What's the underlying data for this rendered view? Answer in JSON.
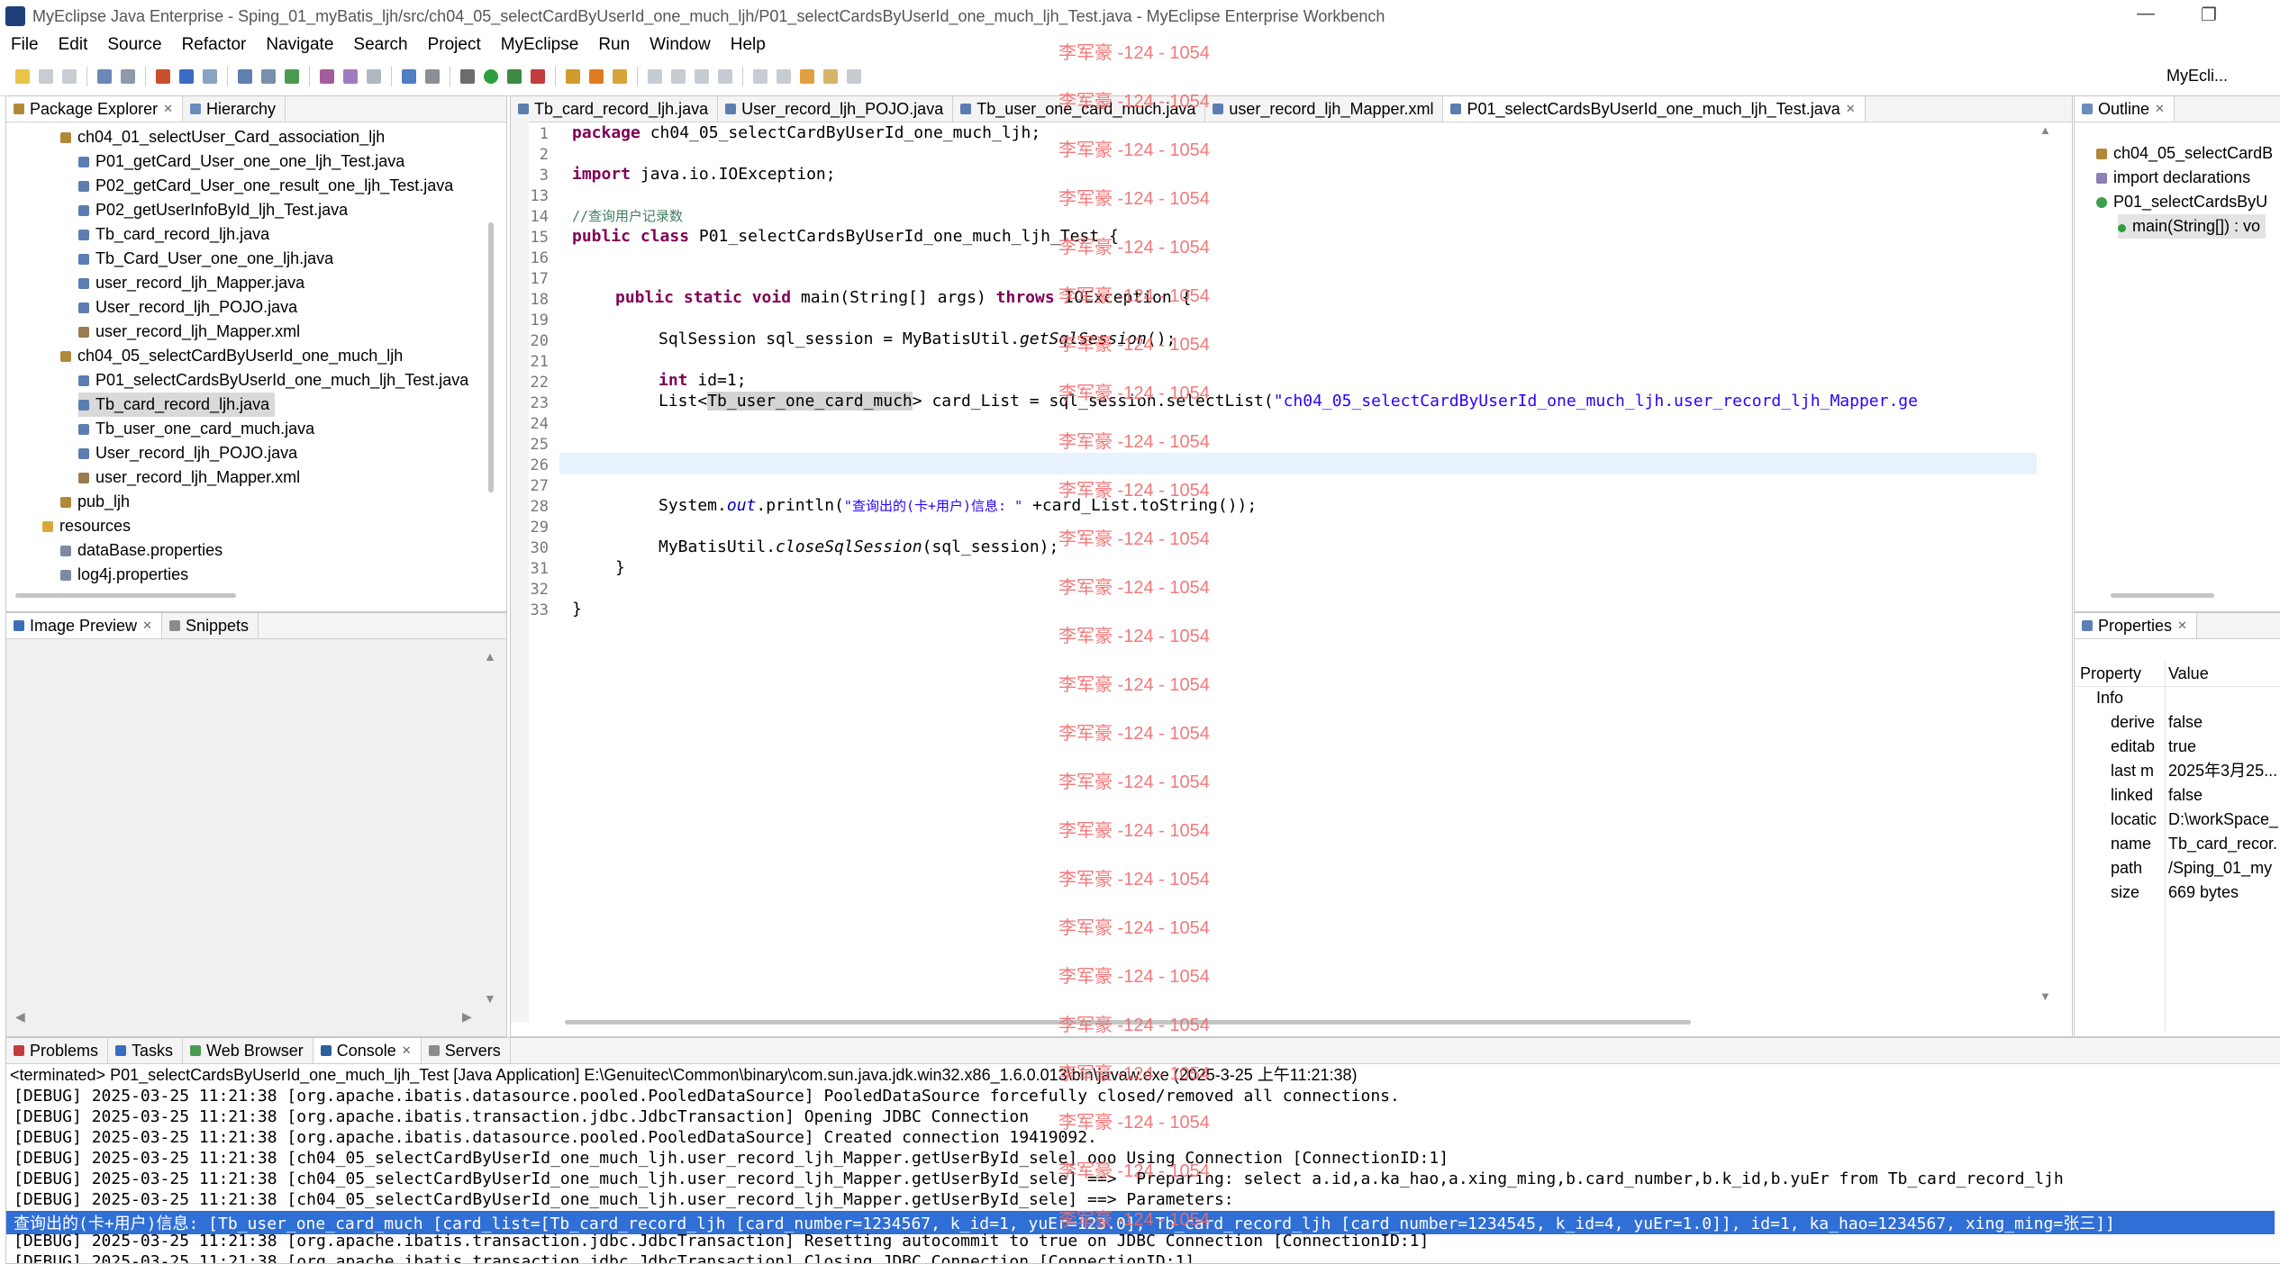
{
  "window": {
    "title": "MyEclipse Java Enterprise - Sping_01_myBatis_ljh/src/ch04_05_selectCardByUserId_one_much_ljh/P01_selectCardsByUserId_one_much_ljh_Test.java - MyEclipse Enterprise Workbench",
    "minimize": "—",
    "restore": "❐"
  },
  "menu": [
    "File",
    "Edit",
    "Source",
    "Refactor",
    "Navigate",
    "Search",
    "Project",
    "MyEclipse",
    "Run",
    "Window",
    "Help"
  ],
  "perspective": {
    "label": "MyEcli..."
  },
  "package_explorer": {
    "tab_label": "Package Explorer",
    "hierarchy_label": "Hierarchy",
    "items": [
      {
        "label": "ch04_01_selectUser_Card_association_ljh",
        "kind": "package"
      },
      {
        "label": "P01_getCard_User_one_one_ljh_Test.java",
        "kind": "java"
      },
      {
        "label": "P02_getCard_User_one_result_one_ljh_Test.java",
        "kind": "java"
      },
      {
        "label": "P02_getUserInfoById_ljh_Test.java",
        "kind": "java"
      },
      {
        "label": "Tb_card_record_ljh.java",
        "kind": "java"
      },
      {
        "label": "Tb_Card_User_one_one_ljh.java",
        "kind": "java"
      },
      {
        "label": "user_record_ljh_Mapper.java",
        "kind": "java"
      },
      {
        "label": "User_record_ljh_POJO.java",
        "kind": "java"
      },
      {
        "label": "user_record_ljh_Mapper.xml",
        "kind": "xml"
      },
      {
        "label": "ch04_05_selectCardByUserId_one_much_ljh",
        "kind": "package"
      },
      {
        "label": "P01_selectCardsByUserId_one_much_ljh_Test.java",
        "kind": "java"
      },
      {
        "label": "Tb_card_record_ljh.java",
        "kind": "java",
        "selected": true
      },
      {
        "label": "Tb_user_one_card_much.java",
        "kind": "java"
      },
      {
        "label": "User_record_ljh_POJO.java",
        "kind": "java"
      },
      {
        "label": "user_record_ljh_Mapper.xml",
        "kind": "xml"
      },
      {
        "label": "pub_ljh",
        "kind": "package"
      },
      {
        "label": "resources",
        "kind": "folder"
      },
      {
        "label": "dataBase.properties",
        "kind": "props"
      },
      {
        "label": "log4j.properties",
        "kind": "props"
      }
    ]
  },
  "image_preview": {
    "tab_label": "Image Preview",
    "snippets_label": "Snippets"
  },
  "editor": {
    "tabs": [
      {
        "label": "Tb_card_record_ljh.java"
      },
      {
        "label": "User_record_ljh_POJO.java"
      },
      {
        "label": "Tb_user_one_card_much.java"
      },
      {
        "label": "user_record_ljh_Mapper.xml"
      },
      {
        "label": "P01_selectCardsByUserId_one_much_ljh_Test.java",
        "active": true
      }
    ],
    "line_numbers": [
      "1",
      "2",
      "3",
      "13",
      "14",
      "15",
      "16",
      "17",
      "18",
      "19",
      "20",
      "21",
      "22",
      "23",
      "24",
      "25",
      "26",
      "27",
      "28",
      "29",
      "30",
      "31",
      "32",
      "33"
    ],
    "code": {
      "l1_kw": "package",
      "l1_rest": " ch04_05_selectCardByUserId_one_much_ljh;",
      "l3_kw": "import",
      "l3_rest": " java.io.IOException;",
      "l14_comment": "//查询用户记录数",
      "l15_kw": "public class",
      "l15_rest": " P01_selectCardsByUserId_one_much_ljh_Test {",
      "l18_kw": "public static void",
      "l18_mid": " main(String[] args) ",
      "l18_kw2": "throws",
      "l18_rest": " IOException {",
      "l20_a": "SqlSession sql_session = MyBatisUtil.",
      "l20_it": "getSqlSession",
      "l20_b": "();",
      "l22_kw": "int",
      "l22_rest": " id=1;",
      "l23_a": "List<",
      "l23_type": "Tb_user_one_card_much",
      "l23_b": "> card_List = sql_session.selectList(",
      "l23_str": "\"ch04_05_selectCardByUserId_one_much_ljh.user_record_ljh_Mapper.ge",
      "l27_a": "System.",
      "l27_fld": "out",
      "l27_b": ".println(",
      "l27_str": "\"查询出的(卡+用户)信息: \"",
      "l27_c": " +card_List.toString());",
      "l29_a": "MyBatisUtil.",
      "l29_it": "closeSqlSession",
      "l29_b": "(sql_session);",
      "l30": "}",
      "l32": "}"
    }
  },
  "watermark": {
    "text": "李军豪 -124 - 1054"
  },
  "outline": {
    "tab_label": "Outline",
    "items": [
      {
        "label": "ch04_05_selectCardB"
      },
      {
        "label": "import declarations"
      },
      {
        "label": "P01_selectCardsByU"
      },
      {
        "label": "main(String[]) : vo"
      }
    ]
  },
  "properties": {
    "tab_label": "Properties",
    "header_property": "Property",
    "header_value": "Value",
    "section": "Info",
    "rows": [
      {
        "key": "derive",
        "value": "false"
      },
      {
        "key": "editab",
        "value": "true"
      },
      {
        "key": "last m",
        "value": "2025年3月25..."
      },
      {
        "key": "linked",
        "value": "false"
      },
      {
        "key": "locatic",
        "value": "D:\\workSpace_"
      },
      {
        "key": "name",
        "value": "Tb_card_recor."
      },
      {
        "key": "path",
        "value": "/Sping_01_my"
      },
      {
        "key": "size",
        "value": "669  bytes"
      }
    ]
  },
  "bottom_tabs": [
    {
      "label": "Problems"
    },
    {
      "label": "Tasks"
    },
    {
      "label": "Web Browser"
    },
    {
      "label": "Console",
      "active": true
    },
    {
      "label": "Servers"
    }
  ],
  "console": {
    "header": "<terminated> P01_selectCardsByUserId_one_much_ljh_Test [Java Application] E:\\Genuitec\\Common\\binary\\com.sun.java.jdk.win32.x86_1.6.0.013\\bin\\javaw.exe (2025-3-25 上午11:21:38)",
    "lines": [
      "[DEBUG] 2025-03-25 11:21:38 [org.apache.ibatis.datasource.pooled.PooledDataSource] PooledDataSource forcefully closed/removed all connections.",
      "[DEBUG] 2025-03-25 11:21:38 [org.apache.ibatis.transaction.jdbc.JdbcTransaction] Opening JDBC Connection",
      "[DEBUG] 2025-03-25 11:21:38 [org.apache.ibatis.datasource.pooled.PooledDataSource] Created connection 19419092.",
      "[DEBUG] 2025-03-25 11:21:38 [ch04_05_selectCardByUserId_one_much_ljh.user_record_ljh_Mapper.getUserById_sele] ooo Using Connection [ConnectionID:1]",
      "[DEBUG] 2025-03-25 11:21:38 [ch04_05_selectCardByUserId_one_much_ljh.user_record_ljh_Mapper.getUserById_sele] ==>  Preparing: select a.id,a.ka_hao,a.xing_ming,b.card_number,b.k_id,b.yuEr from Tb_card_record_ljh",
      "[DEBUG] 2025-03-25 11:21:38 [ch04_05_selectCardByUserId_one_much_ljh.user_record_ljh_Mapper.getUserById_sele] ==> Parameters:",
      "查询出的(卡+用户)信息: [Tb_user_one_card_much [card_list=[Tb_card_record_ljh [card_number=1234567, k_id=1, yuEr=123.0], Tb_card_record_ljh [card_number=1234545, k_id=4, yuEr=1.0]], id=1, ka_hao=1234567, xing_ming=张三]]",
      "[DEBUG] 2025-03-25 11:21:38 [org.apache.ibatis.transaction.jdbc.JdbcTransaction] Resetting autocommit to true on JDBC Connection [ConnectionID:1]",
      "[DEBUG] 2025-03-25 11:21:38 [org.apache.ibatis.transaction.jdbc.JdbcTransaction] Closing JDBC Connection [ConnectionID:1]"
    ]
  }
}
